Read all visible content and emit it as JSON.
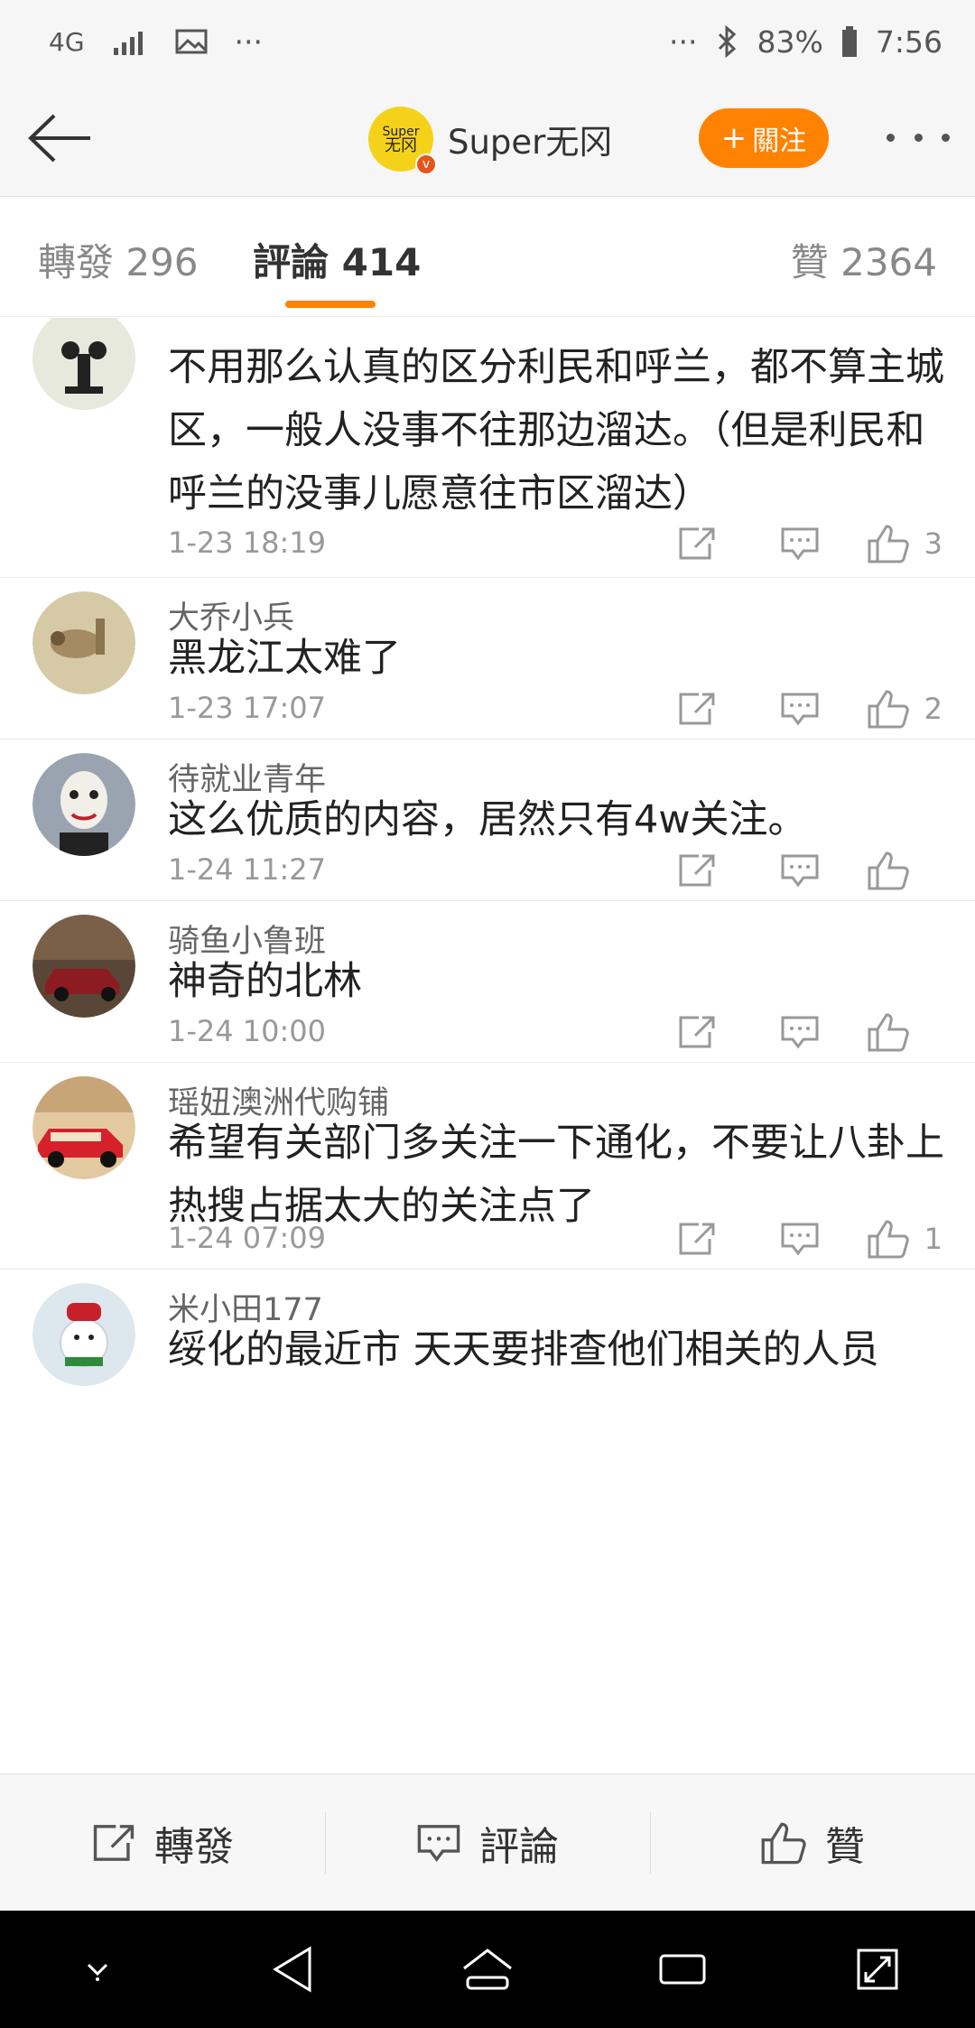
{
  "status_bar": {
    "network": "4G",
    "more_left": "···",
    "more_right": "···",
    "battery": "83%",
    "time": "7:56"
  },
  "header": {
    "account_name": "Super无冈",
    "logo_text_top": "Super",
    "logo_text_bottom": "无冈",
    "verified_badge": "v",
    "follow_label": "關注",
    "follow_prefix": "+",
    "brand_color": "#ff8200"
  },
  "tabs": [
    {
      "label": "轉發 296"
    },
    {
      "label": "評論 414"
    },
    {
      "label": "贊 2364"
    }
  ],
  "comments": [
    {
      "name": "",
      "text": "不用那么认真的区分利民和呼兰，都不算主城区，一般人没事不往那边溜达。（但是利民和呼兰的没事儿愿意往市区溜达）",
      "time": "1-23 18:19",
      "likes": "3",
      "avatar": "cartoon-figure-avatar"
    },
    {
      "name": "大乔小兵",
      "text": "黑龙江太难了",
      "time": "1-23 17:07",
      "likes": "2",
      "avatar": "painting-avatar"
    },
    {
      "name": "待就业青年",
      "text": "这么优质的内容，居然只有4w关注。",
      "time": "1-24 11:27",
      "likes": "",
      "avatar": "mask-avatar"
    },
    {
      "name": "骑鱼小鲁班",
      "text": "神奇的北林",
      "time": "1-24 10:00",
      "likes": "",
      "avatar": "car-avatar"
    },
    {
      "name": "瑶妞澳洲代购铺",
      "text": "希望有关部门多关注一下通化，不要让八卦上热搜占据太大的关注点了",
      "time": "1-24 07:09",
      "likes": "1",
      "avatar": "red-car-avatar"
    },
    {
      "name": "米小田177",
      "text": "绥化的最近市 天天要排查他们相关的人员",
      "time": "",
      "likes": "",
      "avatar": "snowman-avatar"
    }
  ],
  "bottom_bar": {
    "repost_label": "轉發",
    "comment_label": "評論",
    "like_label": "贊"
  }
}
